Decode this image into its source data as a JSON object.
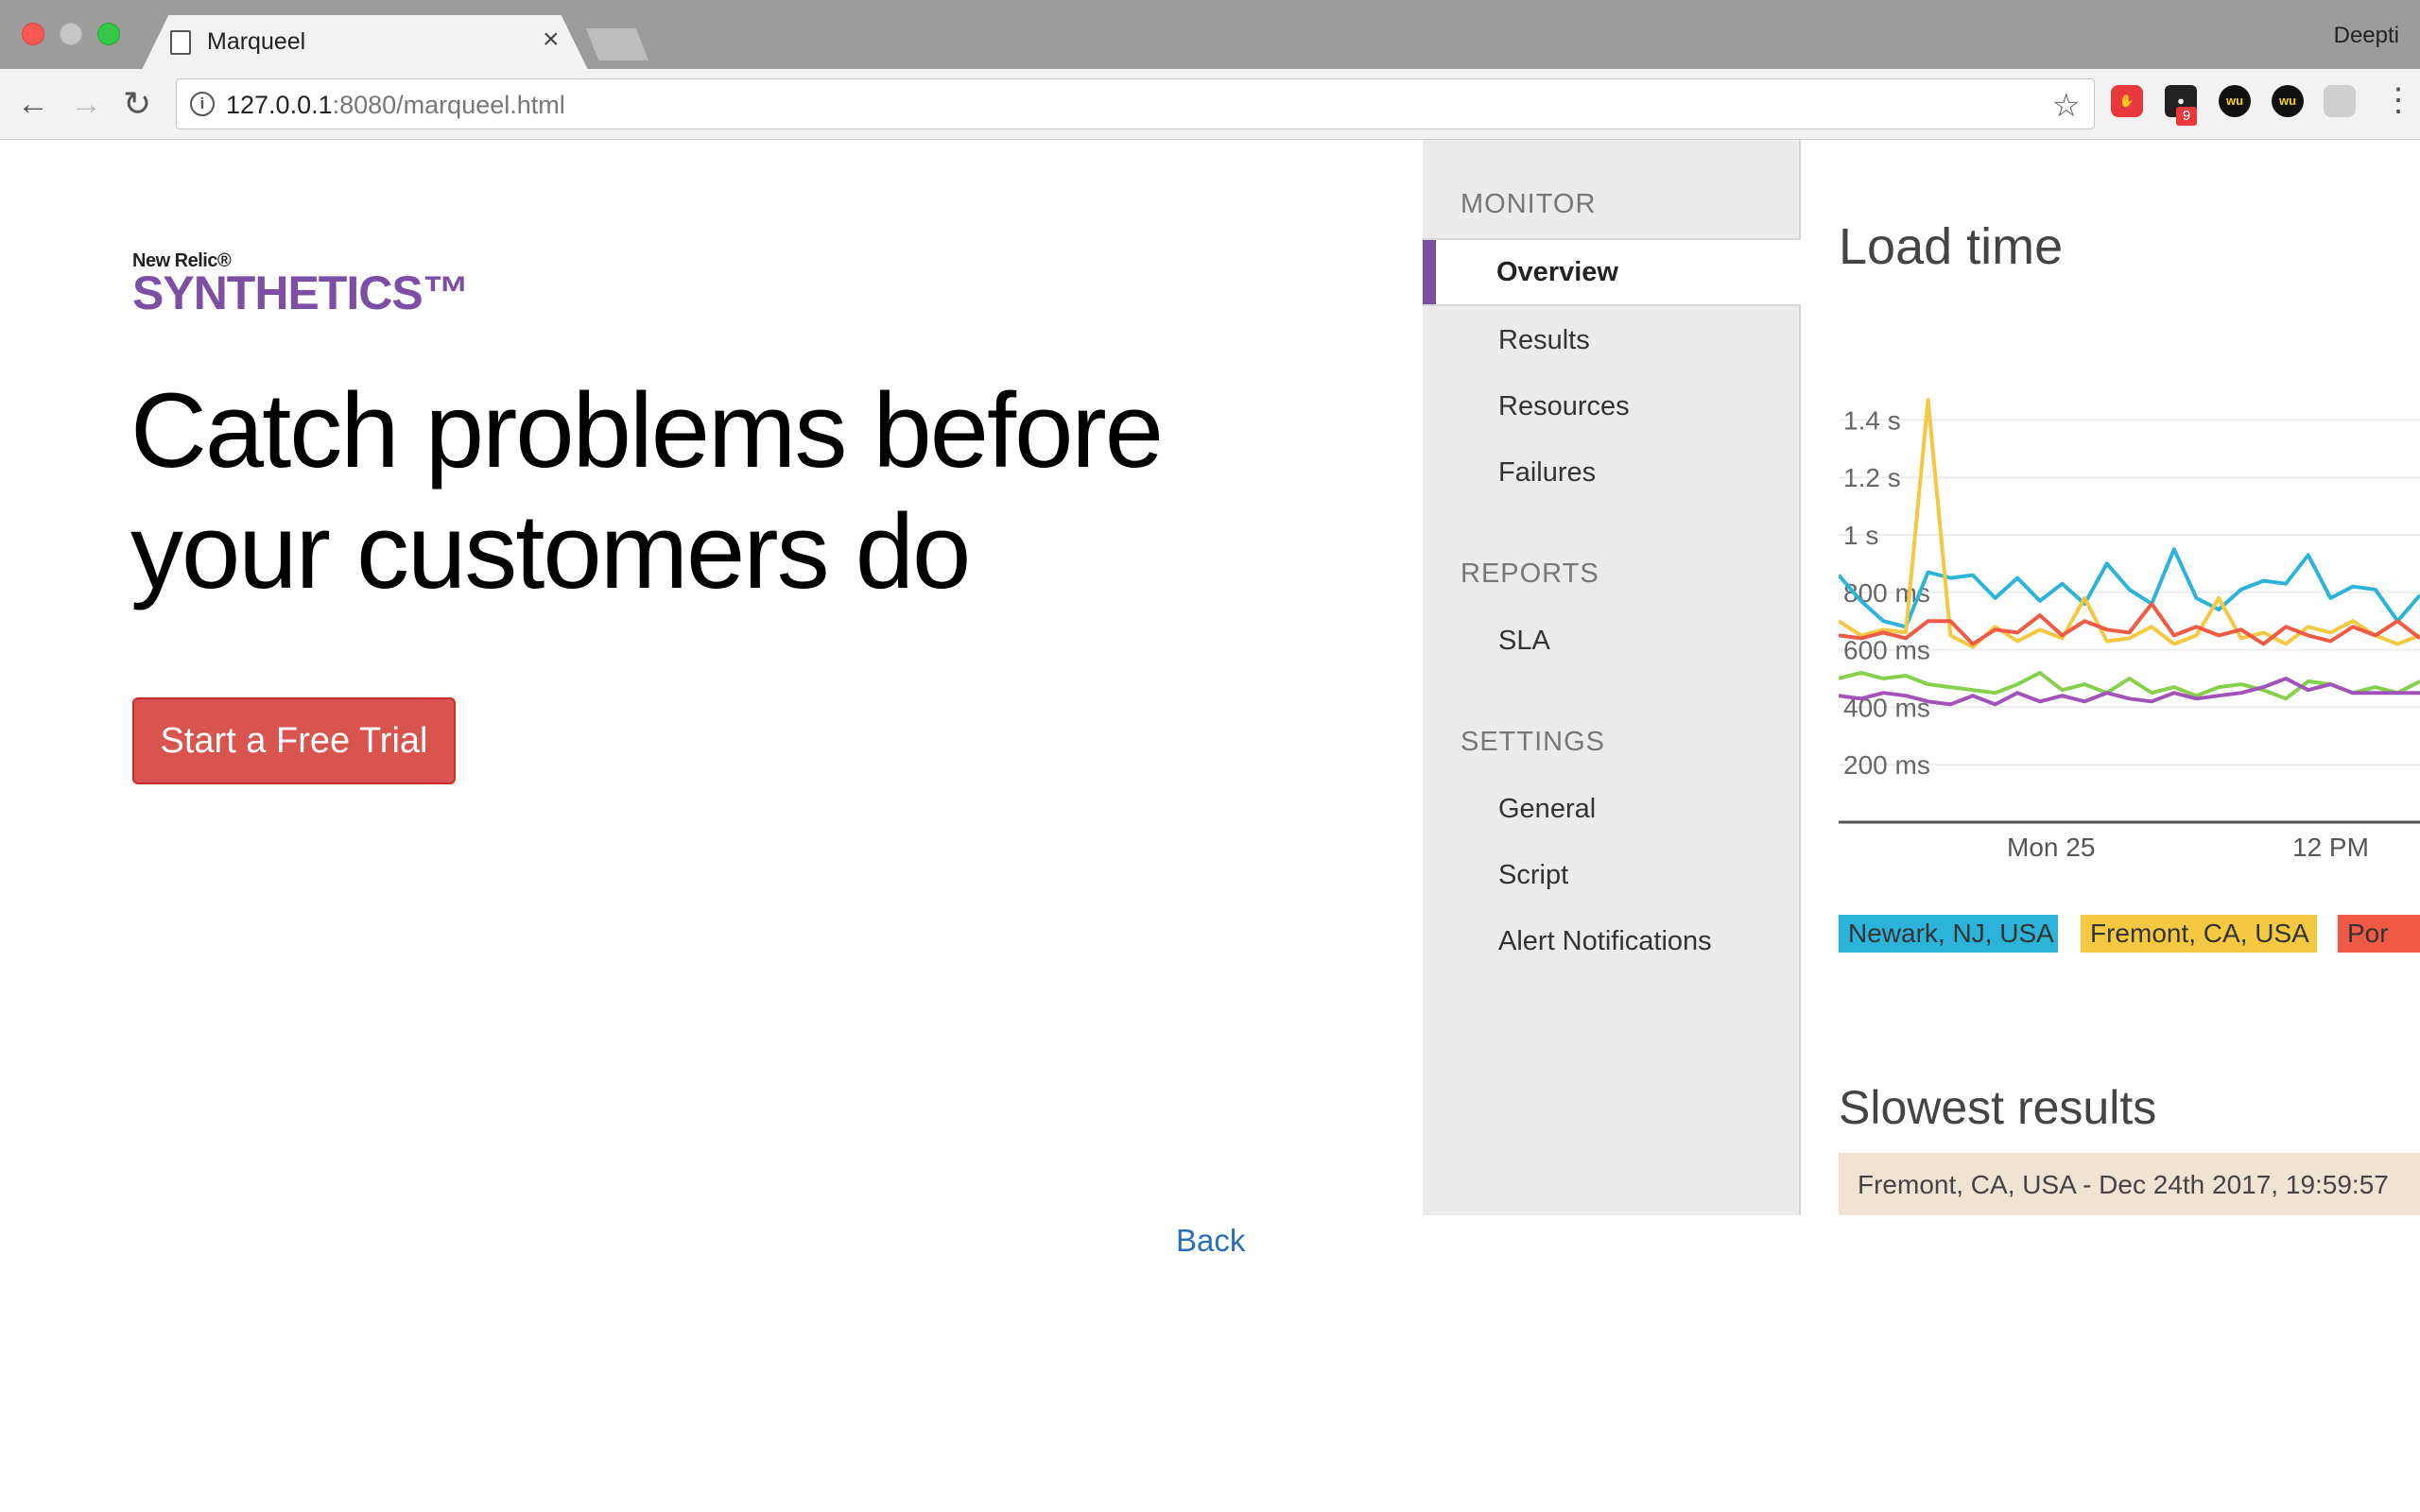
{
  "browser": {
    "tab_title": "Marqueel",
    "tab_close": "×",
    "profile_name": "Deepti",
    "url_host": "127.0.0.1",
    "url_rest": ":8080/marqueel.html",
    "extension_badge": "9",
    "wu_label": "wu"
  },
  "page": {
    "logo_small": "New Relic®",
    "logo_big": "SYNTHETICS™",
    "headline_line1": "Catch problems before",
    "headline_line2": "your customers do",
    "cta_label": "Start a Free Trial",
    "back_label": "Back",
    "colors": {
      "cta": "#d9534f",
      "link": "#2a6ebb",
      "brand_purple": "#7c4fa5"
    }
  },
  "panel": {
    "sidebar": {
      "monitor_heading": "MONITOR",
      "monitor_items": [
        "Overview",
        "Results",
        "Resources",
        "Failures"
      ],
      "active_item": "Overview",
      "reports_heading": "REPORTS",
      "reports_items": [
        "SLA"
      ],
      "settings_heading": "SETTINGS",
      "settings_items": [
        "General",
        "Script",
        "Alert Notifications"
      ]
    },
    "load_title": "Load time",
    "slowest_title": "Slowest results",
    "slowest_row": "Fremont, CA, USA - Dec 24th 2017, 19:59:57"
  },
  "chart_data": {
    "type": "line",
    "title": "Load time",
    "y_ticks": [
      "1.4 s",
      "1.2 s",
      "1 s",
      "800 ms",
      "600 ms",
      "400 ms",
      "200 ms"
    ],
    "ylim": [
      0,
      1400
    ],
    "x_ticks": [
      "Mon 25",
      "12 PM"
    ],
    "grid": true,
    "legend": [
      "Newark, NJ, USA",
      "Fremont, CA, USA",
      "Por"
    ],
    "series": [
      {
        "name": "Newark, NJ, USA",
        "color": "#2bb3d9",
        "values": [
          860,
          770,
          700,
          680,
          870,
          850,
          860,
          780,
          850,
          770,
          830,
          760,
          900,
          810,
          760,
          950,
          780,
          740,
          810,
          840,
          830,
          930,
          780,
          820,
          810,
          700,
          790
        ]
      },
      {
        "name": "Fremont, CA, USA",
        "color": "#f5c842",
        "values": [
          700,
          650,
          670,
          660,
          1470,
          650,
          610,
          680,
          630,
          670,
          640,
          780,
          630,
          640,
          680,
          620,
          650,
          780,
          640,
          660,
          620,
          680,
          660,
          700,
          650,
          620,
          650
        ]
      },
      {
        "name": "Por",
        "color": "#ee5a44",
        "values": [
          650,
          640,
          660,
          640,
          700,
          700,
          620,
          670,
          660,
          720,
          650,
          700,
          670,
          660,
          760,
          650,
          680,
          650,
          670,
          620,
          680,
          650,
          630,
          680,
          650,
          700,
          640
        ]
      },
      {
        "name": "",
        "color": "#86d04b",
        "values": [
          500,
          520,
          500,
          510,
          480,
          470,
          460,
          450,
          480,
          520,
          460,
          480,
          450,
          500,
          450,
          470,
          440,
          470,
          480,
          460,
          430,
          490,
          480,
          450,
          470,
          450,
          490
        ]
      },
      {
        "name": "",
        "color": "#a053b8",
        "values": [
          440,
          430,
          450,
          440,
          420,
          410,
          440,
          410,
          450,
          420,
          440,
          420,
          450,
          430,
          420,
          450,
          430,
          440,
          450,
          470,
          500,
          460,
          480,
          450,
          450,
          450,
          450
        ]
      }
    ]
  }
}
